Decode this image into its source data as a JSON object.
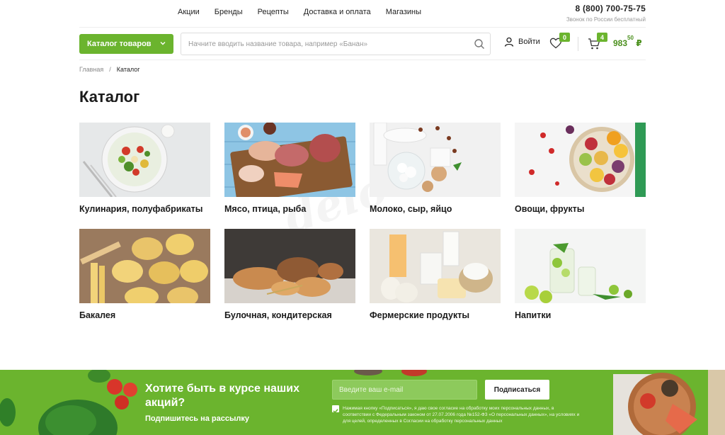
{
  "nav": {
    "items": [
      "Акции",
      "Бренды",
      "Рецепты",
      "Доставка и оплата",
      "Магазины"
    ]
  },
  "phone": {
    "number": "8 (800) 700-75-75",
    "note": "Звонок по России бесплатный"
  },
  "header": {
    "catalog_label": "Каталог товаров",
    "search_placeholder": "Начните вводить название товара, например «Банан»",
    "login_label": "Войти",
    "favorites_count": "0",
    "cart_count": "4",
    "cart_total_main": "983",
    "cart_total_kop": "50",
    "currency": "₽"
  },
  "breadcrumb": {
    "home": "Главная",
    "separator": "/",
    "current": "Каталог"
  },
  "page": {
    "title": "Каталог"
  },
  "categories": [
    {
      "label": "Кулинария, полуфабрикаты"
    },
    {
      "label": "Мясо, птица, рыба"
    },
    {
      "label": "Молоко, сыр, яйцо"
    },
    {
      "label": "Овощи, фрукты"
    },
    {
      "label": "Бакалея"
    },
    {
      "label": "Булочная, кондитерская"
    },
    {
      "label": "Фермерские продукты"
    },
    {
      "label": "Напитки"
    }
  ],
  "newsletter": {
    "heading": "Хотите быть в курсе наших акций?",
    "subheading": "Подпишитесь на рассылку",
    "email_placeholder": "Введите ваш e-mail",
    "button_label": "Подписаться",
    "consent": "Нажимая кнопку «Подписаться», я даю свое согласие на обработку моих персональных данных, в соответствии с Федеральным законом от 27.07.2006 года №152-ФЗ «О персональных данных», на условиях и для целей, определенных в Согласии на обработку персональных данных"
  },
  "colors": {
    "accent": "#6bb42e",
    "price": "#4a8f1c"
  }
}
